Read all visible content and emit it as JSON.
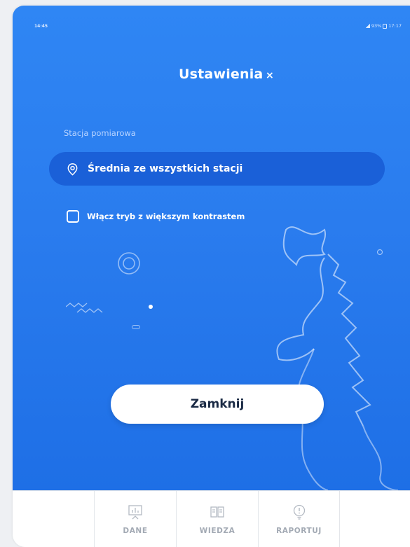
{
  "status_bar": {
    "time_left": "14:45",
    "right_text": "93%",
    "clock_right": "17:17"
  },
  "header": {
    "title": "Ustawienia",
    "close_symbol": "×"
  },
  "settings": {
    "station_label": "Stacja pomiarowa",
    "station_value": "Średnia ze wszystkich stacji",
    "contrast_label": "Włącz tryb z większym kontrastem",
    "contrast_checked": false
  },
  "close_button": {
    "label": "Zamknij"
  },
  "bottom_nav": {
    "items": [
      {
        "label": "DANE",
        "icon": "chart-icon"
      },
      {
        "label": "WIEDZA",
        "icon": "book-icon"
      },
      {
        "label": "RAPORTUJ",
        "icon": "alert-bulb-icon"
      }
    ]
  },
  "colors": {
    "background_top": "#2f86f4",
    "background_bottom": "#1e6fe6",
    "select_bg": "#1a60d8",
    "button_bg": "#ffffff",
    "nav_text": "#a3aab4"
  }
}
